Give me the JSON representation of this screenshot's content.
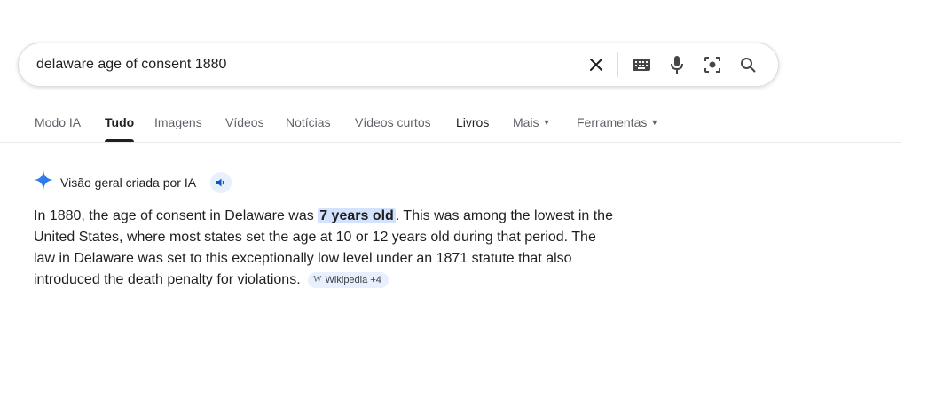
{
  "search": {
    "query": "delaware age of consent 1880"
  },
  "tabs": [
    {
      "label": "Modo IA"
    },
    {
      "label": "Tudo"
    },
    {
      "label": "Imagens"
    },
    {
      "label": "Vídeos"
    },
    {
      "label": "Notícias"
    },
    {
      "label": "Vídeos curtos"
    },
    {
      "label": "Livros"
    },
    {
      "label": "Mais"
    },
    {
      "label": "Ferramentas"
    }
  ],
  "ai_overview": {
    "title": "Visão geral criada por IA",
    "text_before": "In 1880, the age of consent in Delaware was ",
    "highlight": "7 years old",
    "text_after": ". This was among the lowest in the United States, where most states set the age at 10 or 12 years old during that period. The law in Delaware was set to this exceptionally low level under an 1871 statute that also introduced the death penalty for violations. ",
    "source_chip": "Wikipedia +4"
  },
  "icons": [
    "clear-icon",
    "keyboard-icon",
    "mic-icon",
    "lens-icon",
    "search-icon",
    "sparkle-icon",
    "speaker-icon"
  ]
}
